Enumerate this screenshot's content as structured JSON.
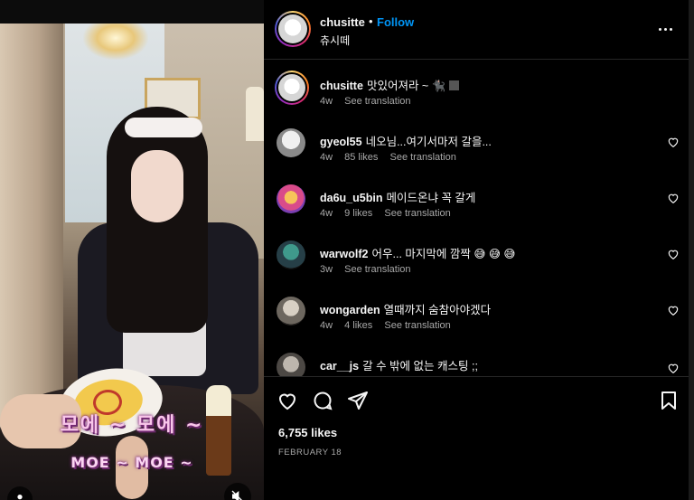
{
  "post": {
    "username": "chusitte",
    "dot": "•",
    "follow_label": "Follow",
    "subtitle": "츄시떼",
    "caption_text": "맛있어져라 ~ 🐈‍⬛",
    "caption_time": "4w",
    "caption_translate": "See translation",
    "likes": "6,755 likes",
    "date": "FEBRUARY 18"
  },
  "media": {
    "overlay_line1": "모에 ~ 모에 ~",
    "overlay_line2": "MOE ~ MOE ~"
  },
  "comments": [
    {
      "user": "gyeol55",
      "text": "네오님...여기서마저 갈을...",
      "time": "4w",
      "likes": "85 likes",
      "translate": "See translation"
    },
    {
      "user": "da6u_u5bin",
      "text": "메이드온냐 꼭 갈게",
      "time": "4w",
      "likes": "9 likes",
      "translate": "See translation"
    },
    {
      "user": "warwolf2",
      "text": "어우... 마지막에 깜짝 😅 😅 😅",
      "time": "3w",
      "likes": "",
      "translate": "See translation"
    },
    {
      "user": "wongarden",
      "text": "열때까지 숨참아야겠다",
      "time": "4w",
      "likes": "4 likes",
      "translate": "See translation"
    },
    {
      "user": "car__js",
      "text": "갈 수 밖에 없는 캐스팅 ;;",
      "time": "",
      "likes": "",
      "translate": ""
    }
  ],
  "colors": {
    "accent": "#0095f6",
    "background": "#000000",
    "muted": "#a8a8a8",
    "divider": "#262626"
  },
  "icons": {
    "like": "heart-icon",
    "comment": "comment-icon",
    "share": "share-icon",
    "save": "bookmark-icon",
    "more": "more-icon",
    "mute": "muted-icon",
    "profile": "user-icon"
  }
}
